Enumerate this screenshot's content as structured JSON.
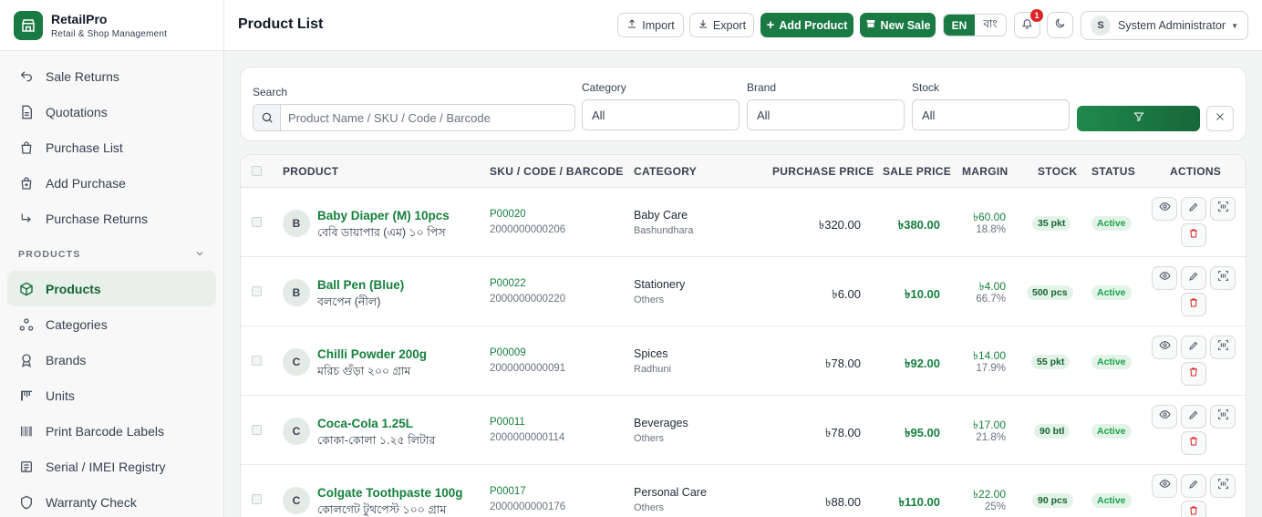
{
  "app": {
    "name": "RetailPro",
    "subtitle": "Retail & Shop Management"
  },
  "sidebar": {
    "items_top": [
      {
        "label": "Sale Returns",
        "icon": "return-icon"
      },
      {
        "label": "Quotations",
        "icon": "document-icon"
      },
      {
        "label": "Purchase List",
        "icon": "bag-icon"
      },
      {
        "label": "Add Purchase",
        "icon": "bag-plus-icon"
      },
      {
        "label": "Purchase Returns",
        "icon": "return-arrow-icon"
      }
    ],
    "section_label": "PRODUCTS",
    "items_products": [
      {
        "label": "Products",
        "icon": "box-icon",
        "active": true
      },
      {
        "label": "Categories",
        "icon": "categories-icon"
      },
      {
        "label": "Brands",
        "icon": "badge-icon"
      },
      {
        "label": "Units",
        "icon": "ruler-icon"
      },
      {
        "label": "Print Barcode Labels",
        "icon": "barcode-icon"
      },
      {
        "label": "Serial / IMEI Registry",
        "icon": "serial-icon"
      },
      {
        "label": "Warranty Check",
        "icon": "shield-icon"
      }
    ]
  },
  "header": {
    "title": "Product List",
    "import_label": "Import",
    "export_label": "Export",
    "add_product_label": "Add Product",
    "new_sale_label": "New Sale",
    "lang_en": "EN",
    "lang_bn": "বাং",
    "notification_count": "1",
    "user_initial": "S",
    "user_name": "System Administrator"
  },
  "filters": {
    "search_label": "Search",
    "search_placeholder": "Product Name / SKU / Code / Barcode",
    "category_label": "Category",
    "category_value": "All",
    "brand_label": "Brand",
    "brand_value": "All",
    "stock_label": "Stock",
    "stock_value": "All"
  },
  "table": {
    "columns": [
      "PRODUCT",
      "SKU / CODE / BARCODE",
      "CATEGORY",
      "PURCHASE PRICE",
      "SALE PRICE",
      "MARGIN",
      "STOCK",
      "STATUS",
      "ACTIONS"
    ],
    "rows": [
      {
        "initial": "B",
        "name": "Baby Diaper (M) 10pcs",
        "name_bn": "বেবি ডায়াপার (এম) ১০ পিস",
        "sku": "P00020",
        "barcode": "2000000000206",
        "category": "Baby Care",
        "brand": "Bashundhara",
        "purchase_price": "৳320.00",
        "sale_price": "৳380.00",
        "margin": "৳60.00",
        "margin_pct": "18.8%",
        "stock": "35 pkt",
        "status": "Active"
      },
      {
        "initial": "B",
        "name": "Ball Pen (Blue)",
        "name_bn": "বলপেন (নীল)",
        "sku": "P00022",
        "barcode": "2000000000220",
        "category": "Stationery",
        "brand": "Others",
        "purchase_price": "৳6.00",
        "sale_price": "৳10.00",
        "margin": "৳4.00",
        "margin_pct": "66.7%",
        "stock": "500 pcs",
        "status": "Active"
      },
      {
        "initial": "C",
        "name": "Chilli Powder 200g",
        "name_bn": "মরিচ গুঁড়া ২০০ গ্রাম",
        "sku": "P00009",
        "barcode": "2000000000091",
        "category": "Spices",
        "brand": "Radhuni",
        "purchase_price": "৳78.00",
        "sale_price": "৳92.00",
        "margin": "৳14.00",
        "margin_pct": "17.9%",
        "stock": "55 pkt",
        "status": "Active"
      },
      {
        "initial": "C",
        "name": "Coca-Cola 1.25L",
        "name_bn": "কোকা-কোলা ১.২৫ লিটার",
        "sku": "P00011",
        "barcode": "2000000000114",
        "category": "Beverages",
        "brand": "Others",
        "purchase_price": "৳78.00",
        "sale_price": "৳95.00",
        "margin": "৳17.00",
        "margin_pct": "21.8%",
        "stock": "90 btl",
        "status": "Active"
      },
      {
        "initial": "C",
        "name": "Colgate Toothpaste 100g",
        "name_bn": "কোলগেট টুথপেস্ট ১০০ গ্রাম",
        "sku": "P00017",
        "barcode": "2000000000176",
        "category": "Personal Care",
        "brand": "Others",
        "purchase_price": "৳88.00",
        "sale_price": "৳110.00",
        "margin": "৳22.00",
        "margin_pct": "25%",
        "stock": "90 pcs",
        "status": "Active"
      }
    ]
  },
  "colors": {
    "primary": "#1a7a44",
    "accent_text": "#15803d",
    "danger": "#dc2626"
  }
}
